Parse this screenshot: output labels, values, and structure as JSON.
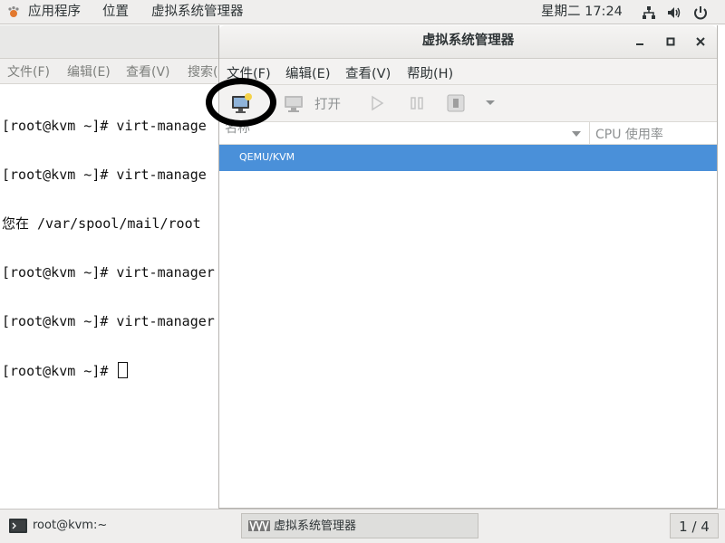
{
  "topbar": {
    "apps_label": "应用程序",
    "places_label": "位置",
    "active_app_label": "虚拟系统管理器",
    "clock": "星期二 17:24",
    "tray_icons": [
      "network-icon",
      "volume-icon",
      "power-icon"
    ]
  },
  "terminal": {
    "menu": [
      "文件(F)",
      "编辑(E)",
      "查看(V)",
      "搜索("
    ],
    "lines": [
      "[root@kvm ~]# virt-manage",
      "[root@kvm ~]# virt-manage",
      "您在 /var/spool/mail/root ",
      "[root@kvm ~]# virt-manager",
      "[root@kvm ~]# virt-manager",
      "[root@kvm ~]# "
    ]
  },
  "virt_manager": {
    "title": "虚拟系统管理器",
    "menu": [
      "文件(F)",
      "编辑(E)",
      "查看(V)",
      "帮助(H)"
    ],
    "toolbar": {
      "new_vm_icon": "new-vm-icon",
      "open_icon": "monitor-icon",
      "open_label": "打开",
      "run_icon": "play-icon",
      "pause_icon": "pause-icon",
      "shutdown_icon": "stop-icon",
      "dropdown_icon": "chevron-down-icon"
    },
    "columns": [
      "名称",
      "CPU 使用率"
    ],
    "rows": [
      "QEMU/KVM"
    ]
  },
  "taskbar": {
    "terminal_task": "root@kvm:~",
    "vm_task": "虚拟系统管理器",
    "workspace": "1 / 4"
  },
  "colors": {
    "selection": "#4a90d9",
    "panel": "#efeeed",
    "highlight_ring": "#000000"
  }
}
